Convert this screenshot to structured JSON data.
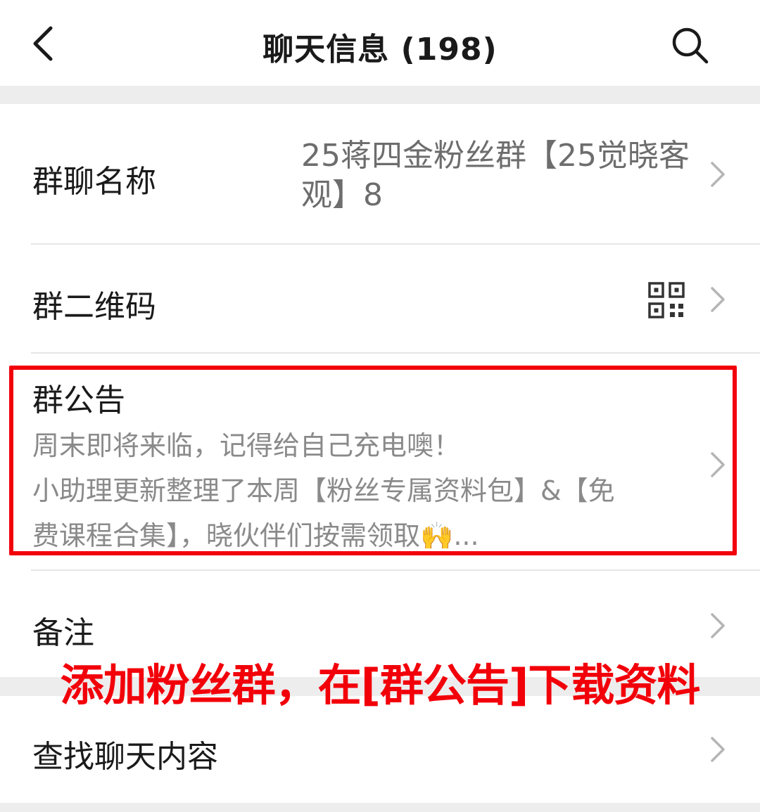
{
  "header": {
    "title": "聊天信息 (198)"
  },
  "settings": {
    "group_name": {
      "label": "群聊名称",
      "value": "25蒋四金粉丝群【25觉晓客观】8"
    },
    "group_qr": {
      "label": "群二维码"
    },
    "group_notice": {
      "label": "群公告",
      "lines": [
        "周末即将来临，记得给自己充电噢！",
        "小助理更新整理了本周【粉丝专属资料包】&【免",
        "费课程合集】，晓伙伴们按需领取🙌..."
      ]
    },
    "remark": {
      "label": "备注"
    },
    "search_chat": {
      "label": "查找聊天内容"
    }
  },
  "overlay": {
    "caption": "添加粉丝群，在[群公告]下载资料"
  },
  "colors": {
    "highlight": "#f2000a",
    "secondary_text": "#8a8a8a",
    "background": "#ededed"
  }
}
